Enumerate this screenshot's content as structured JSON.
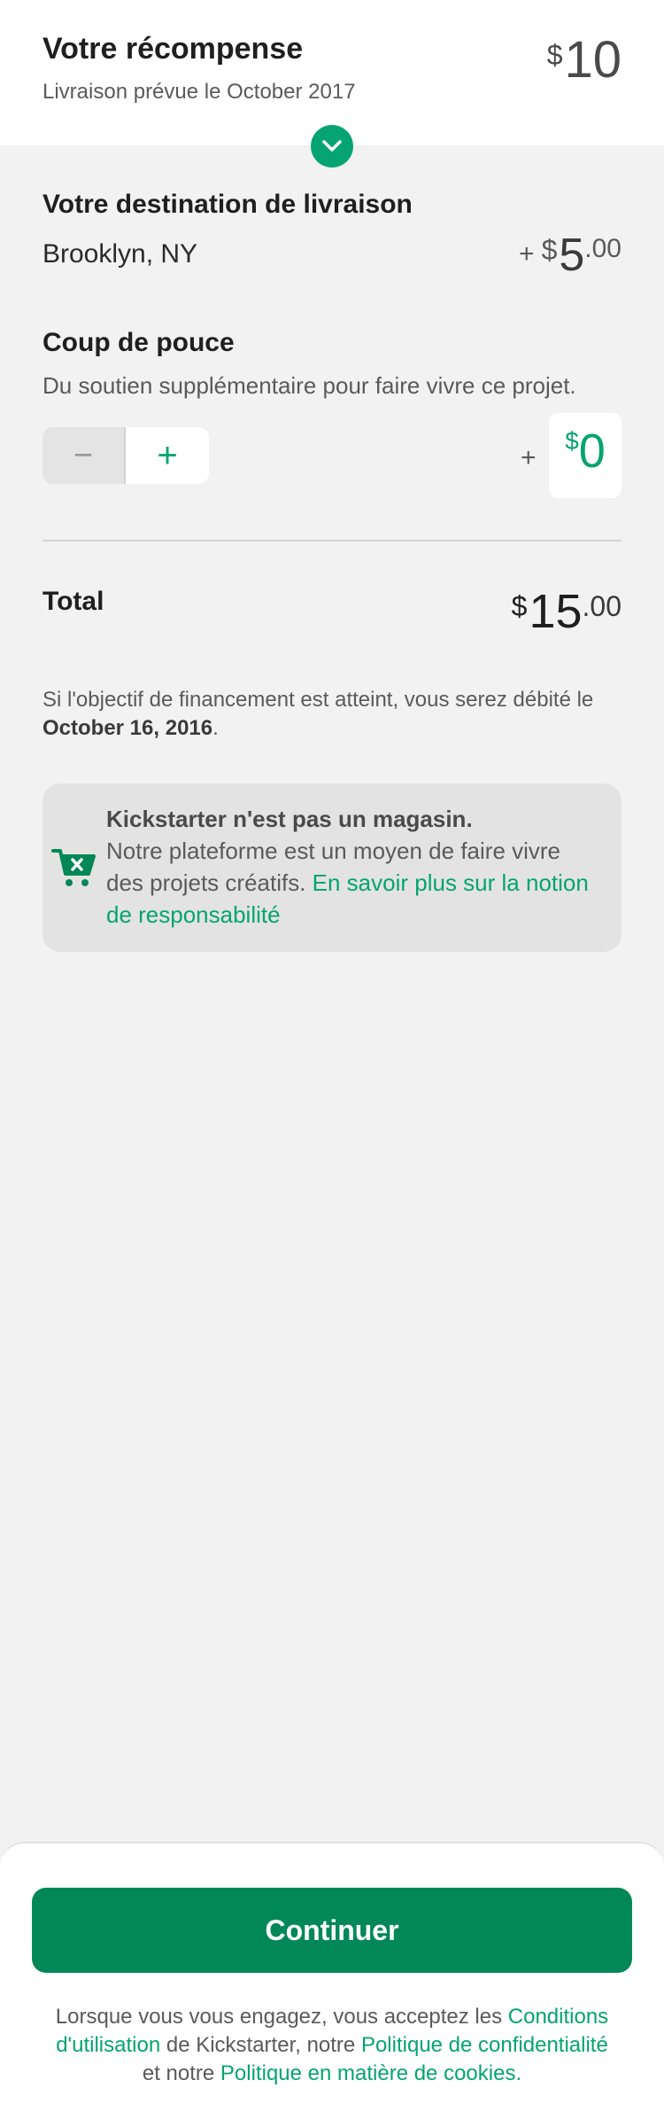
{
  "reward": {
    "title": "Votre récompense",
    "delivery": "Livraison prévue le October 2017",
    "currency": "$",
    "amount": "10"
  },
  "shipping": {
    "title": "Votre destination de livraison",
    "location": "Brooklyn, NY",
    "plus": "+",
    "currency": "$",
    "amount": "5",
    "decimals": ".00"
  },
  "bonus": {
    "title": "Coup de pouce",
    "description": "Du soutien supplémentaire pour faire vivre ce projet.",
    "minus_symbol": "−",
    "plus_symbol": "+",
    "plus_prefix": "+",
    "currency": "$",
    "amount": "0"
  },
  "total": {
    "label": "Total",
    "currency": "$",
    "amount": "15",
    "decimals": ".00"
  },
  "charge": {
    "text_before": "Si l'objectif de financement est atteint, vous serez débité le ",
    "date": "October 16, 2016",
    "text_after": "."
  },
  "notice": {
    "title": "Kickstarter n'est pas un magasin.",
    "body": "Notre plateforme est un moyen de faire vivre des projets créatifs. ",
    "link": "En savoir plus sur la notion de responsabilité",
    "icon": "cart-icon"
  },
  "footer": {
    "button": "Continuer",
    "legal_1": "Lorsque vous vous engagez, vous acceptez les ",
    "link_terms": "Conditions d'utilisation",
    "legal_2": " de Kickstarter, notre ",
    "link_privacy": "Politique de confidentialité",
    "legal_3": " et notre ",
    "link_cookies": "Politique en matière de cookies",
    "legal_4": "."
  },
  "colors": {
    "accent": "#05a470",
    "button": "#028858",
    "background": "#f2f2f2"
  }
}
